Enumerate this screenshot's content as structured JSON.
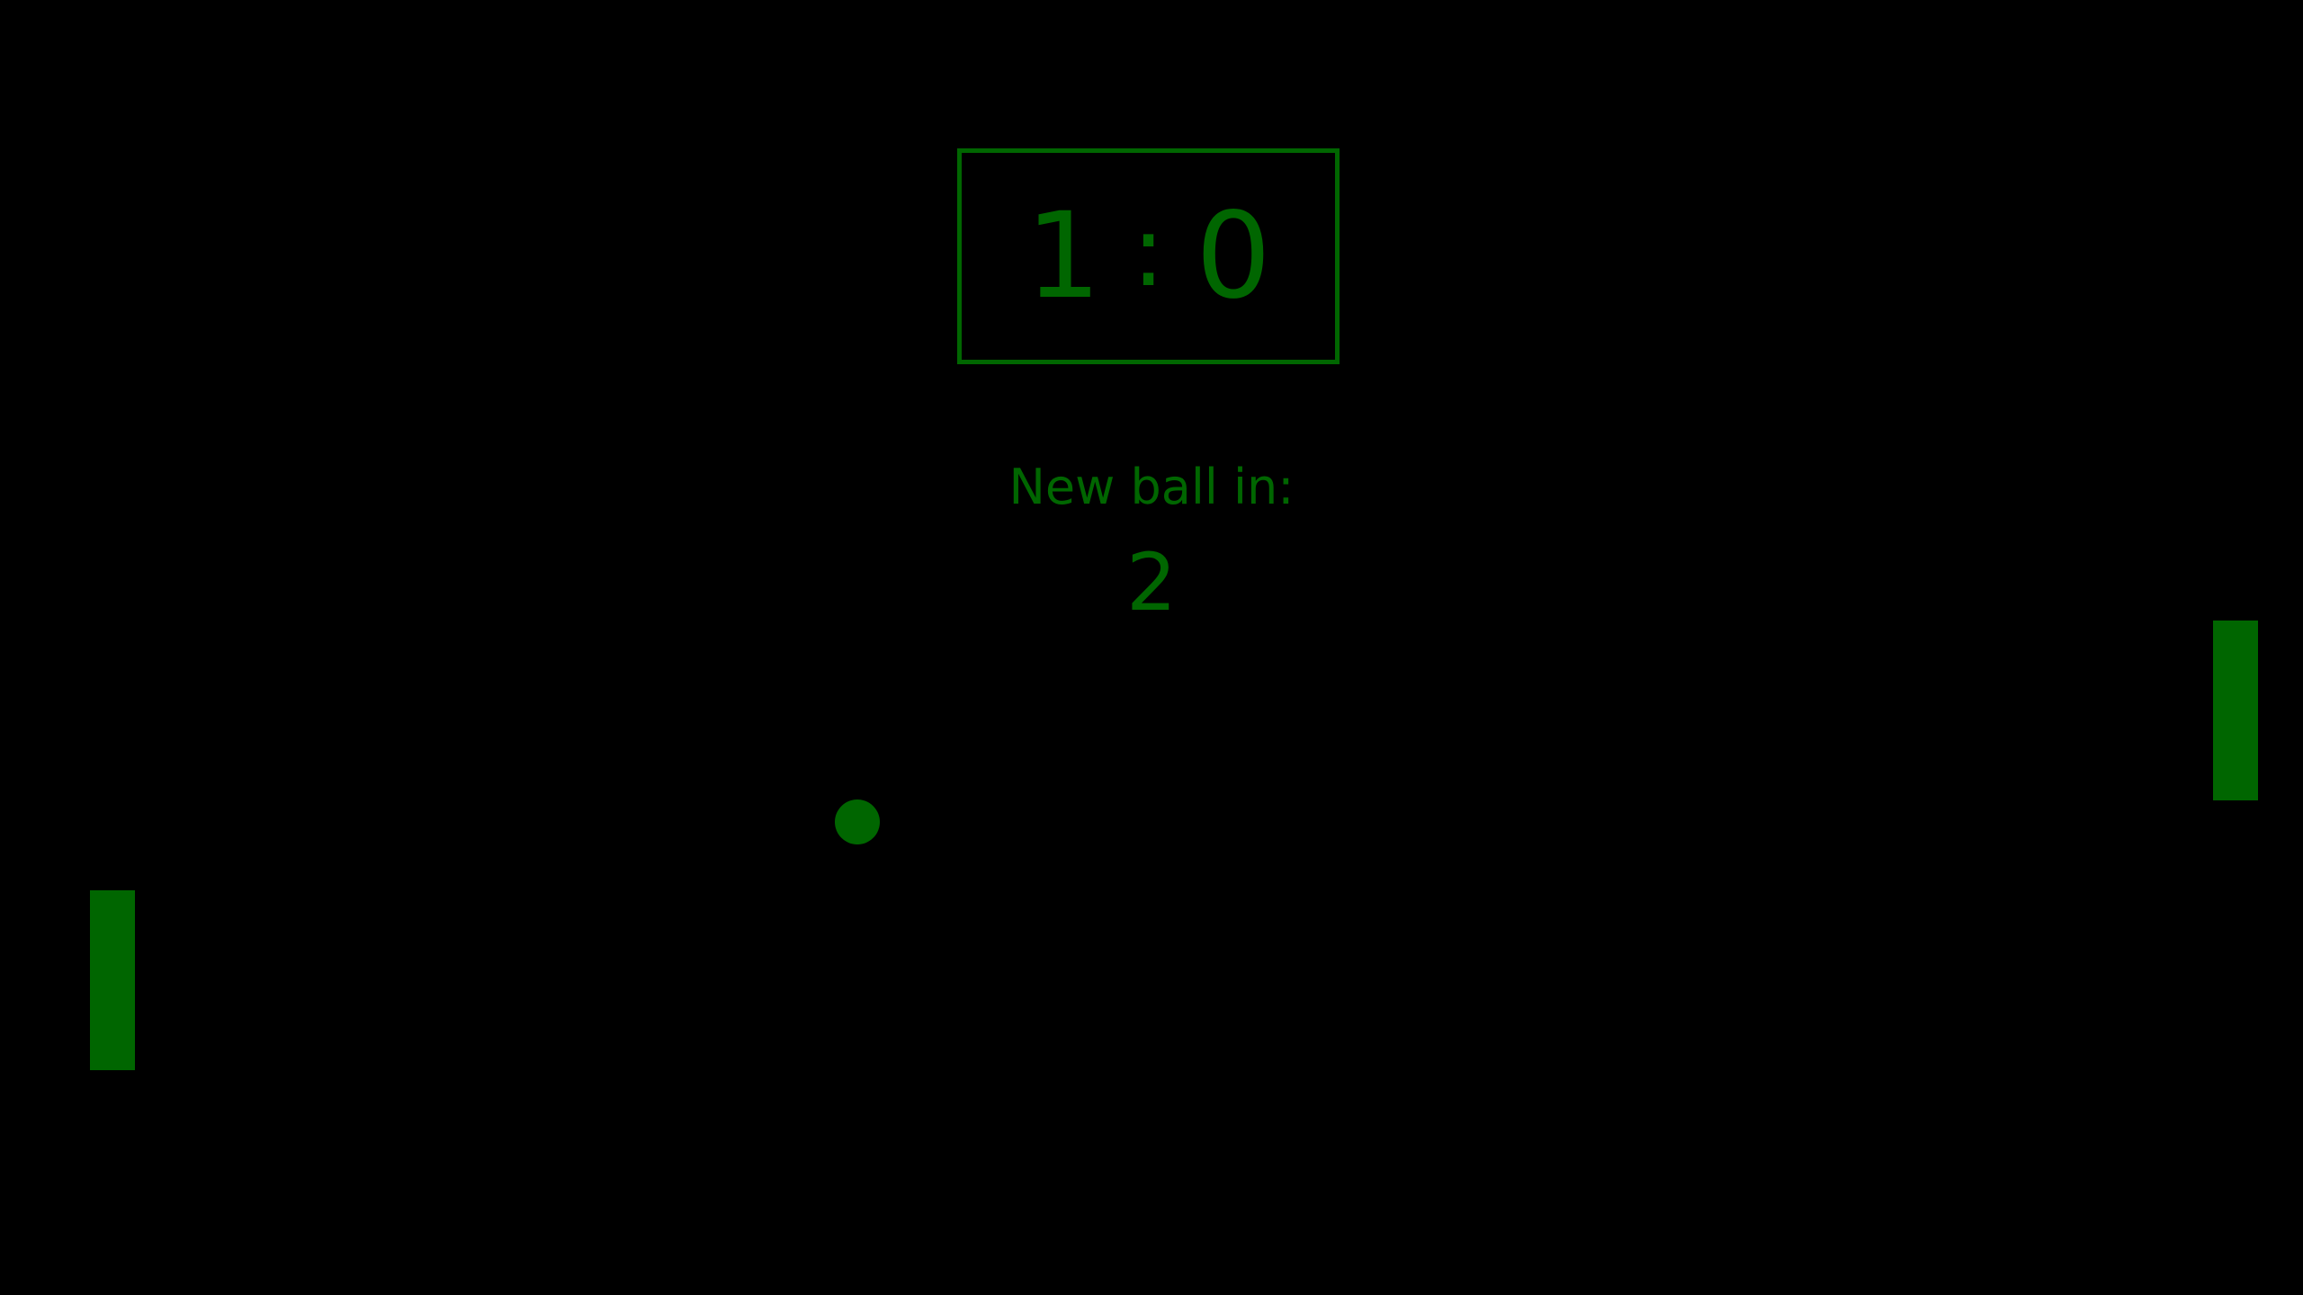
{
  "game": {
    "score": {
      "left": "1",
      "separator": ":",
      "right": "0"
    },
    "countdown": {
      "label": "New ball in:",
      "value": "2"
    }
  },
  "colors": {
    "background": "#000000",
    "accent": "#006600"
  }
}
